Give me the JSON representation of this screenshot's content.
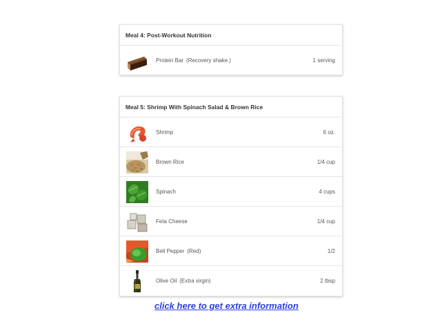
{
  "meals": [
    {
      "title": "Meal 4: Post-Workout Nutrition",
      "items": [
        {
          "name": "Protein Bar",
          "note": "(Recovery shake.)",
          "qty": "1 serving",
          "icon": "protein-bar-icon"
        }
      ]
    },
    {
      "title": "Meal 5: Shrimp With Spinach Salad & Brown Rice",
      "items": [
        {
          "name": "Shrimp",
          "note": "",
          "qty": "6 oz.",
          "icon": "shrimp-icon"
        },
        {
          "name": "Brown Rice",
          "note": "",
          "qty": "1/4 cup",
          "icon": "brown-rice-icon"
        },
        {
          "name": "Spinach",
          "note": "",
          "qty": "4 cups",
          "icon": "spinach-icon"
        },
        {
          "name": "Feta Cheese",
          "note": "",
          "qty": "1/4 cup",
          "icon": "feta-cheese-icon"
        },
        {
          "name": "Bell Pepper",
          "note": "(Red)",
          "qty": "1/2",
          "icon": "bell-pepper-icon"
        },
        {
          "name": "Olive Oil",
          "note": "(Extra virgin)",
          "qty": "2 tbsp",
          "icon": "olive-oil-icon"
        }
      ]
    }
  ],
  "link": {
    "label": "click here to get extra information"
  },
  "colors": {
    "link": "#2b3fe0",
    "text": "#555555",
    "title": "#333333"
  }
}
